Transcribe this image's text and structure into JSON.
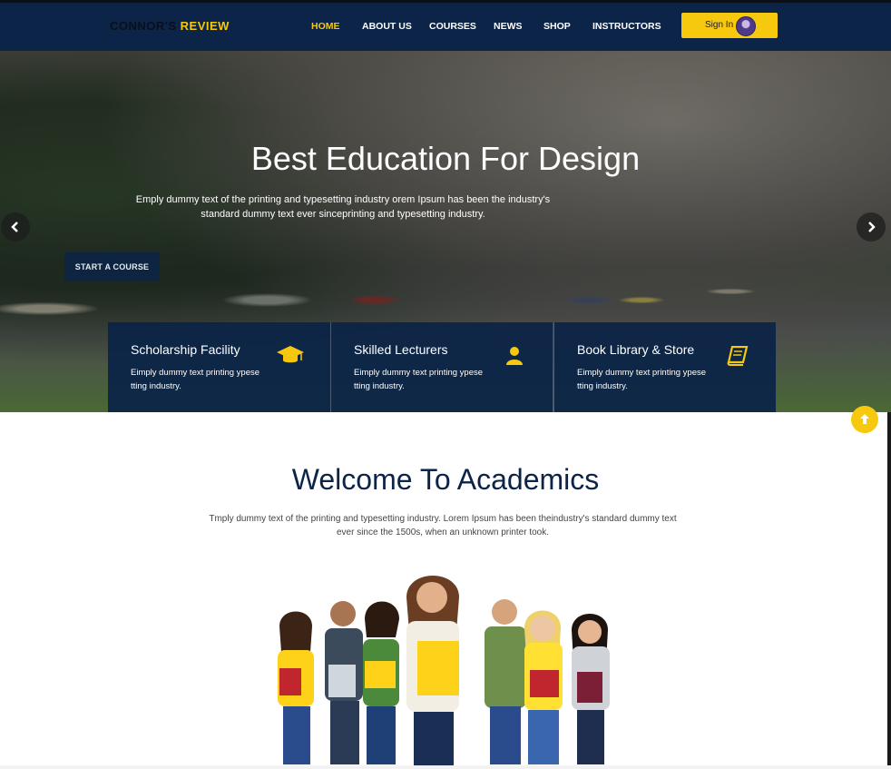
{
  "header": {
    "logo_part1": "CONNOR'S",
    "logo_part2": "REVIEW",
    "nav": [
      "HOME",
      "ABOUT US",
      "COURSES",
      "NEWS",
      "SHOP",
      "INSTRUCTORS"
    ],
    "active_nav": "HOME",
    "signin_label": "Sign In"
  },
  "hero": {
    "title": "Best Education For Design",
    "subtitle": "Emply dummy text of the printing and typesetting industry orem Ipsum has been the industry's standard dummy text ever sinceprinting and typesetting industry.",
    "cta_label": "START A COURSE"
  },
  "features": [
    {
      "title": "Scholarship Facility",
      "text": "Eimply dummy text printing ypese tting industry.",
      "icon": "graduation-cap-icon"
    },
    {
      "title": "Skilled Lecturers",
      "text": "Eimply dummy text printing ypese tting industry.",
      "icon": "user-icon"
    },
    {
      "title": "Book Library & Store",
      "text": "Eimply dummy text printing ypese tting industry.",
      "icon": "book-icon"
    }
  ],
  "welcome": {
    "title": "Welcome To Academics",
    "text": "Tmply dummy text of the printing and typesetting industry. Lorem Ipsum has been theindustry's standard dummy text ever since the 1500s, when an unknown printer took."
  },
  "colors": {
    "navy": "#0b2447",
    "accent": "#f6c90e"
  }
}
